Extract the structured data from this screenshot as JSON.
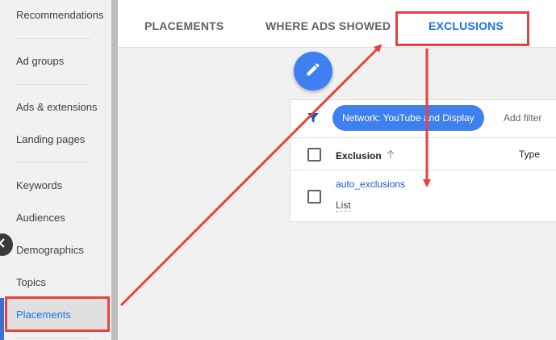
{
  "sidebar": {
    "items": [
      {
        "label": "Recommendations"
      },
      {
        "label": "Ad groups"
      },
      {
        "label": "Ads & extensions"
      },
      {
        "label": "Landing pages"
      },
      {
        "label": "Keywords"
      },
      {
        "label": "Audiences"
      },
      {
        "label": "Demographics"
      },
      {
        "label": "Topics"
      },
      {
        "label": "Placements"
      }
    ],
    "active": "Placements",
    "collapse_icon": "chevron-left-icon"
  },
  "tabs": [
    {
      "label": "PLACEMENTS"
    },
    {
      "label": "WHERE ADS SHOWED"
    },
    {
      "label": "EXCLUSIONS"
    }
  ],
  "active_tab": "EXCLUSIONS",
  "fab": {
    "icon": "pencil-icon"
  },
  "filters": {
    "icon": "filter-icon",
    "chip": "Network: YouTube and Display",
    "add_filter": "Add filter"
  },
  "table": {
    "columns": [
      {
        "label": "Exclusion",
        "sort": "ascending"
      },
      {
        "label": "Type"
      }
    ],
    "rows": [
      {
        "name": "auto_exclusions",
        "type_label": "List"
      }
    ]
  },
  "colors": {
    "accent": "#1a73e8",
    "chip": "#3f80f0",
    "annotation": "#e8423c"
  }
}
